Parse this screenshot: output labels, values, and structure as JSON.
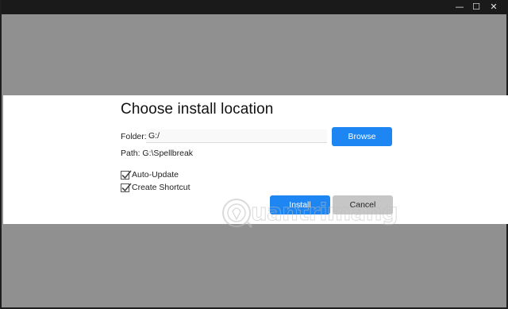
{
  "titlebar": {
    "minimize_icon": "—",
    "maximize_icon": "☐",
    "close_icon": "✕"
  },
  "dialog": {
    "title": "Choose install location",
    "folder_label": "Folder:",
    "folder_value": "G:/",
    "browse_label": "Browse",
    "path_text": "Path: G:\\Spellbreak",
    "auto_update_label": "Auto-Update",
    "auto_update_checked": true,
    "create_shortcut_label": "Create Shortcut",
    "create_shortcut_checked": true,
    "install_label": "Install",
    "cancel_label": "Cancel"
  },
  "watermark": {
    "text": "uantrimang"
  },
  "colors": {
    "accent": "#1e86f2",
    "cancel_bg": "#c6c6c6",
    "backdrop": "#909090",
    "titlebar": "#1a1a1a"
  }
}
